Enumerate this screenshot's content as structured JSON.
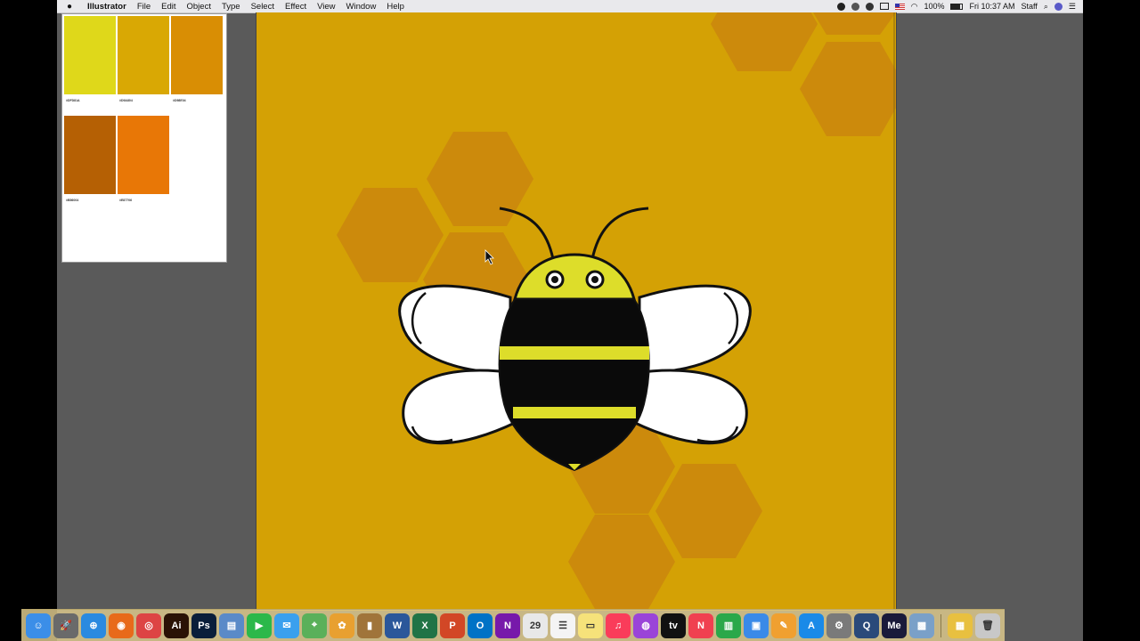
{
  "menubar": {
    "app_name": "Illustrator",
    "menus": [
      "File",
      "Edit",
      "Object",
      "Type",
      "Select",
      "Effect",
      "View",
      "Window",
      "Help"
    ],
    "battery": "100%",
    "clock": "Fri 10:37 AM",
    "user": "Staff"
  },
  "swatches": [
    {
      "hex": "#DFD81A",
      "label": "#DFD81A"
    },
    {
      "hex": "#D9A804",
      "label": "#D9A804"
    },
    {
      "hex": "#D98E04",
      "label": "#D98E04"
    },
    {
      "hex": "#B56004",
      "label": "#B56004"
    },
    {
      "hex": "#E87706",
      "label": "#E87706"
    }
  ],
  "artboard": {
    "background": "#D4A105",
    "hex_color": "#CC8A0C",
    "bee_yellow": "#DDDD2A"
  },
  "dock": {
    "apps": [
      {
        "name": "finder-app",
        "glyph": "☺",
        "color": "#3b8ee8"
      },
      {
        "name": "launchpad-app",
        "glyph": "🚀",
        "color": "#6a6a6a"
      },
      {
        "name": "safari-app",
        "glyph": "⊕",
        "color": "#2a8ae0"
      },
      {
        "name": "firefox-app",
        "glyph": "◉",
        "color": "#e86a1a"
      },
      {
        "name": "chrome-app",
        "glyph": "◎",
        "color": "#d44"
      },
      {
        "name": "illustrator-app",
        "glyph": "Ai",
        "color": "#2a1205"
      },
      {
        "name": "photoshop-app",
        "glyph": "Ps",
        "color": "#0a1e3a"
      },
      {
        "name": "preview-app",
        "glyph": "▤",
        "color": "#5a8ac8"
      },
      {
        "name": "facetime-app",
        "glyph": "▶",
        "color": "#2bb84a"
      },
      {
        "name": "messages-app",
        "glyph": "✉",
        "color": "#3aa0ee"
      },
      {
        "name": "maps-app",
        "glyph": "⌖",
        "color": "#5ab05a"
      },
      {
        "name": "photos-app",
        "glyph": "✿",
        "color": "#e8a030"
      },
      {
        "name": "contacts-app",
        "glyph": "▮",
        "color": "#a0743a"
      },
      {
        "name": "word-app",
        "glyph": "W",
        "color": "#2b579a"
      },
      {
        "name": "excel-app",
        "glyph": "X",
        "color": "#217346"
      },
      {
        "name": "powerpoint-app",
        "glyph": "P",
        "color": "#d24726"
      },
      {
        "name": "outlook-app",
        "glyph": "O",
        "color": "#0072c6"
      },
      {
        "name": "onenote-app",
        "glyph": "N",
        "color": "#7719aa"
      },
      {
        "name": "calendar-app",
        "glyph": "29",
        "color": "#e8e8e8"
      },
      {
        "name": "reminders-app",
        "glyph": "☰",
        "color": "#f4f4f4"
      },
      {
        "name": "notes-app",
        "glyph": "▭",
        "color": "#f6e27a"
      },
      {
        "name": "music-app",
        "glyph": "♫",
        "color": "#fa3c5a"
      },
      {
        "name": "podcasts-app",
        "glyph": "◍",
        "color": "#9a44d8"
      },
      {
        "name": "tv-app",
        "glyph": "tv",
        "color": "#111"
      },
      {
        "name": "news-app",
        "glyph": "N",
        "color": "#f04050"
      },
      {
        "name": "numbers-app",
        "glyph": "▥",
        "color": "#2aa84a"
      },
      {
        "name": "keynote-app",
        "glyph": "▣",
        "color": "#3a8ae8"
      },
      {
        "name": "pages-app",
        "glyph": "✎",
        "color": "#f0a030"
      },
      {
        "name": "app-store-app",
        "glyph": "A",
        "color": "#1a8ae8"
      },
      {
        "name": "system-preferences-app",
        "glyph": "⚙",
        "color": "#7a7a7a"
      },
      {
        "name": "quicktime-app",
        "glyph": "Q",
        "color": "#2a4a7a"
      },
      {
        "name": "media-encoder-app",
        "glyph": "Me",
        "color": "#1a1a3a"
      },
      {
        "name": "image-capture-app",
        "glyph": "▩",
        "color": "#7aa0c8"
      }
    ],
    "trailing": [
      {
        "name": "downloads-stack",
        "glyph": "▦",
        "color": "#e8c040"
      },
      {
        "name": "trash-icon",
        "glyph": "🗑",
        "color": "#c8c8c8"
      }
    ]
  }
}
